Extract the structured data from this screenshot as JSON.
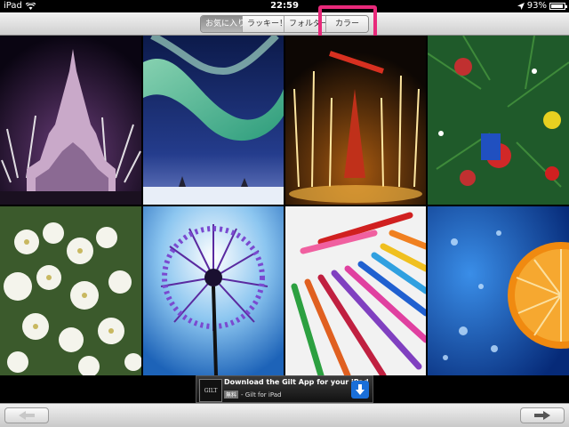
{
  "status": {
    "carrier": "iPad",
    "time": "22:59",
    "battery": "93%",
    "battery_level": 0.93
  },
  "nav": {
    "segments": [
      {
        "label": "お気に入り",
        "selected": true
      },
      {
        "label": "ラッキー！",
        "selected": false
      },
      {
        "label": "フォルダー",
        "selected": false
      },
      {
        "label": "カラー",
        "selected": false
      }
    ]
  },
  "photos": [
    {
      "subject": "castle-fireworks"
    },
    {
      "subject": "aurora"
    },
    {
      "subject": "fountain-lights"
    },
    {
      "subject": "christmas-tree-ornaments"
    },
    {
      "subject": "white-flowers"
    },
    {
      "subject": "dandelion"
    },
    {
      "subject": "colored-pencils-heart"
    },
    {
      "subject": "orange-splash"
    }
  ],
  "ad": {
    "logo": "GILT",
    "title": "Download the Gilt App for your iPad",
    "badge": "無料",
    "subtitle": "- Gilt for iPad"
  },
  "toolbar": {
    "prev_icon": "left-arrow-icon",
    "next_icon": "right-arrow-icon"
  }
}
